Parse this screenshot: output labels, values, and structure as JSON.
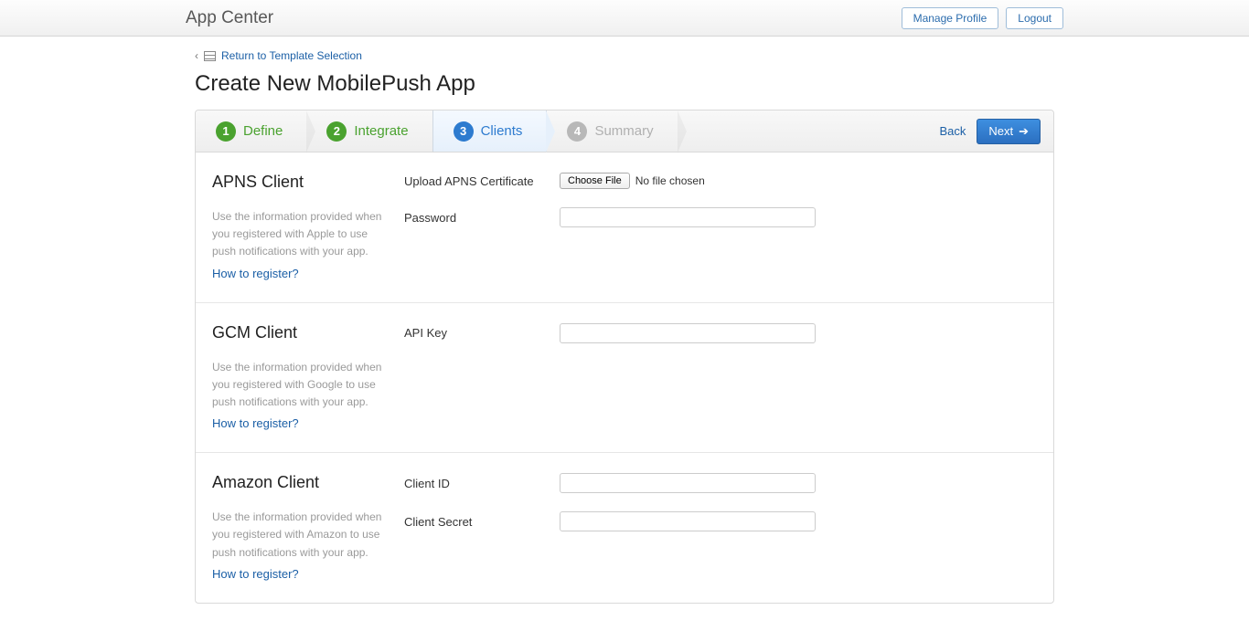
{
  "header": {
    "brand": "App Center",
    "manage_profile": "Manage Profile",
    "logout": "Logout"
  },
  "breadcrumb": {
    "return_link": "Return to Template Selection"
  },
  "page_title": "Create New MobilePush App",
  "wizard": {
    "steps": [
      {
        "num": "1",
        "label": "Define"
      },
      {
        "num": "2",
        "label": "Integrate"
      },
      {
        "num": "3",
        "label": "Clients"
      },
      {
        "num": "4",
        "label": "Summary"
      }
    ],
    "back": "Back",
    "next": "Next"
  },
  "sections": {
    "apns": {
      "title": "APNS Client",
      "help": "Use the information provided when you registered with Apple to use push notifications with your app.",
      "how": "How to register?",
      "upload_label": "Upload APNS Certificate",
      "choose_file": "Choose File",
      "no_file": "No file chosen",
      "password_label": "Password"
    },
    "gcm": {
      "title": "GCM Client",
      "help": "Use the information provided when you registered with Google to use push notifications with your app.",
      "how": "How to register?",
      "api_key_label": "API Key"
    },
    "amazon": {
      "title": "Amazon Client",
      "help": "Use the information provided when you registered with Amazon to use push notifications with your app.",
      "how": "How to register?",
      "client_id_label": "Client ID",
      "client_secret_label": "Client Secret"
    }
  }
}
